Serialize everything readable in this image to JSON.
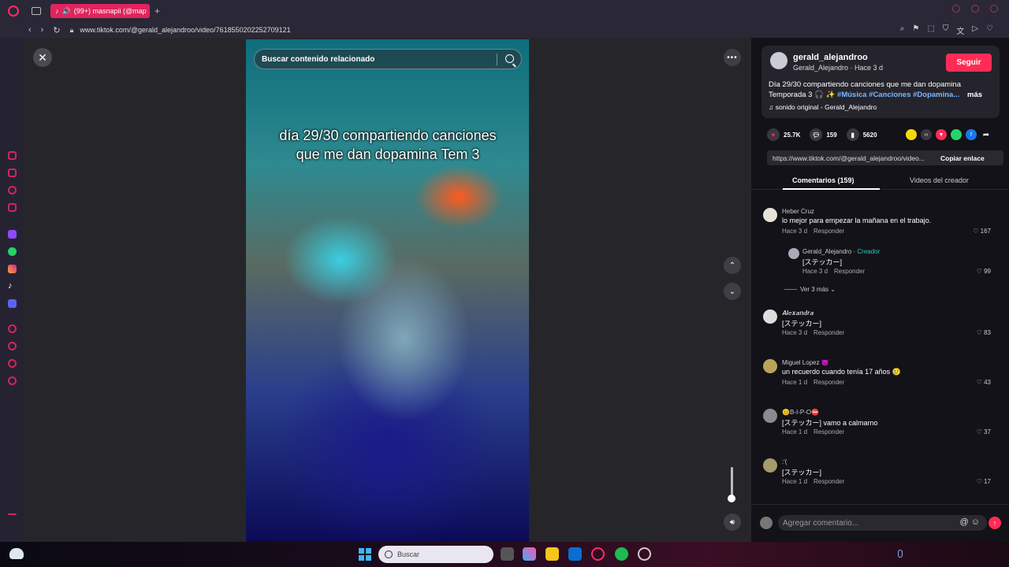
{
  "browser": {
    "tab_title": "(99+) masnapii (@map",
    "new_tab": "+",
    "url": "www.tiktok.com/@gerald_alejandroo/video/7618550202252709121"
  },
  "video": {
    "search_placeholder": "Buscar contenido relacionado",
    "caption": "día 29/30 compartiendo canciones que me dan dopamina Tem 3",
    "more_label": "•••",
    "close_label": "✕"
  },
  "post": {
    "username": "gerald_alejandroo",
    "subtitle": "Gerald_Alejandro · Hace 3 d",
    "follow_label": "Seguir",
    "description": "Día 29/30 compartiendo canciones que me dan dopamina Temporada 3 🎧 ✨",
    "tags": "#Música #Canciones #Dopamina...",
    "more_label": "más",
    "sound": "♫  sonido original - Gerald_Alejandro",
    "likes": "25.7K",
    "comments": "159",
    "saves": "5620",
    "share_link": "https://www.tiktok.com/@gerald_alejandroo/video...",
    "copy_label": "Copiar enlace"
  },
  "tabs": {
    "comments": "Comentarios (159)",
    "creator_videos": "Videos del creador"
  },
  "comments": [
    {
      "author": "Heber Cruz",
      "text": "lo mejor para empezar la mañana en el trabajo.",
      "time": "Hace 3 d",
      "reply": "Responder",
      "likes": "♡ 167"
    },
    {
      "author": "Gerald_Alejandro · ",
      "creator": "Creador",
      "text": "[ステッカー]",
      "time": "Hace 3 d",
      "reply": "Responder",
      "likes": "♡ 99"
    },
    {
      "author": "𝑨𝒍𝒆𝒙𝒂𝒏𝒅𝒓𝒂",
      "text": "[ステッカー]",
      "time": "Hace 3 d",
      "reply": "Responder",
      "likes": "♡ 83"
    },
    {
      "author": "Miguel Lopez 😈",
      "text": "un recuerdo cuando tenía 17 años 🥲",
      "time": "Hace 1 d",
      "reply": "Responder",
      "likes": "♡ 43"
    },
    {
      "author": "😊B-I-P-O⛔",
      "text": "[ステッカー] vamo a calmarno",
      "time": "Hace 1 d",
      "reply": "Responder",
      "likes": "♡ 37"
    },
    {
      "author": ":'(",
      "text": "[ステッカー]",
      "time": "Hace 1 d",
      "reply": "Responder",
      "likes": "♡ 17"
    }
  ],
  "view_more": "Ver 3 más ⌄",
  "compose": {
    "placeholder": "Agregar comentario...",
    "icons": "@ ☺",
    "send": "↑"
  },
  "taskbar": {
    "search_label": "Buscar"
  },
  "colors": {
    "accent": "#fe2c55",
    "link": "#7ab8ff",
    "creator": "#2dc7c9"
  }
}
